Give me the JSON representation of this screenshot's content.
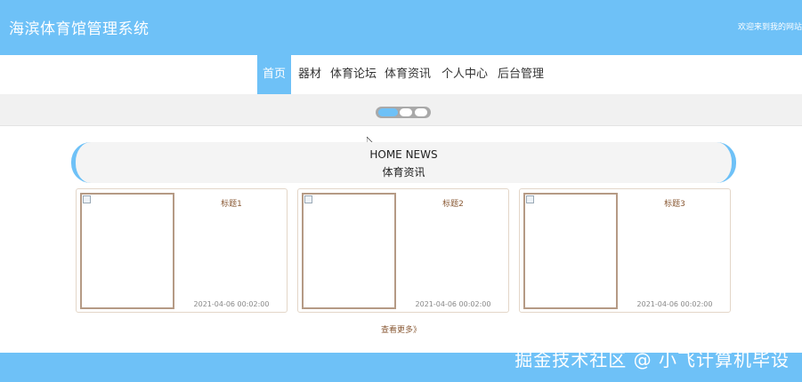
{
  "header": {
    "title": "海滨体育馆管理系统",
    "welcome": "欢迎来到我的网站"
  },
  "nav": {
    "items": [
      {
        "label": "首页",
        "active": true
      },
      {
        "label": "器材",
        "active": false
      },
      {
        "label": "体育论坛",
        "active": false
      },
      {
        "label": "体育资讯",
        "active": false
      },
      {
        "label": "个人中心",
        "active": false
      },
      {
        "label": "后台管理",
        "active": false
      }
    ]
  },
  "carousel": {
    "slide_count": 3,
    "active_index": 0
  },
  "news_section": {
    "heading_en": "HOME NEWS",
    "heading_cn": "体育资讯",
    "cards": [
      {
        "title": "标题1",
        "time": "2021-04-06 00:02:00"
      },
      {
        "title": "标题2",
        "time": "2021-04-06 00:02:00"
      },
      {
        "title": "标题3",
        "time": "2021-04-06 00:02:00"
      }
    ],
    "more_label": "查看更多》"
  },
  "watermark": "掘金技术社区 @ 小飞计算机毕设",
  "colors": {
    "accent": "#6ec1f7",
    "card_border": "#e3d6c8",
    "title_brown": "#8a5a35"
  }
}
